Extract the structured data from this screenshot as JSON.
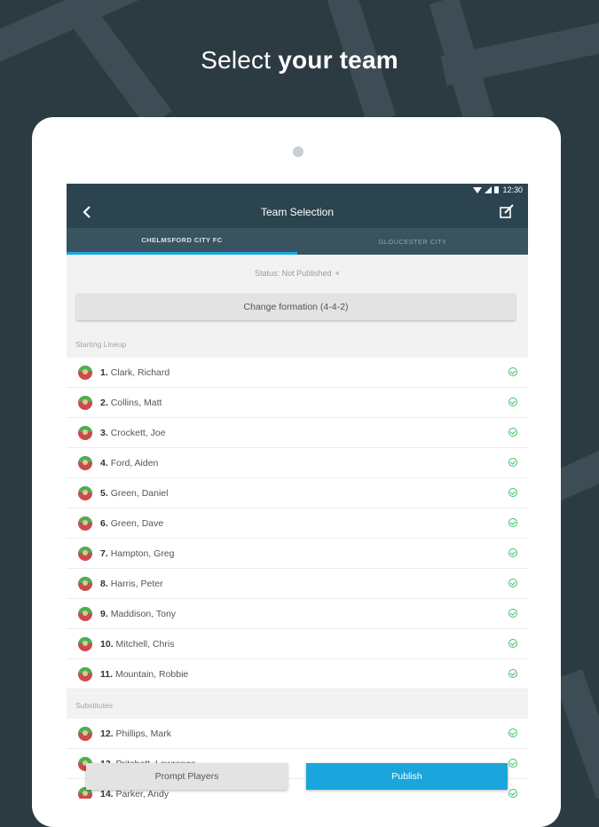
{
  "headline": {
    "light": "Select ",
    "bold": "your team"
  },
  "status_bar": {
    "time": "12:30"
  },
  "app_bar": {
    "title": "Team Selection",
    "back_icon": "chevron-left-icon",
    "edit_icon": "edit-icon"
  },
  "tabs": [
    {
      "label": "CHELMSFORD CITY FC",
      "active": true
    },
    {
      "label": "GLOUCESTER CITY",
      "active": false
    }
  ],
  "status": {
    "text": "Status: Not Published",
    "close": "×"
  },
  "formation_button": "Change formation (4-4-2)",
  "starting": {
    "label": "Starting Lineup",
    "players": [
      {
        "num": "1.",
        "name": "Clark, Richard"
      },
      {
        "num": "2.",
        "name": "Collins, Matt"
      },
      {
        "num": "3.",
        "name": "Crockett, Joe"
      },
      {
        "num": "4.",
        "name": "Ford, Aiden"
      },
      {
        "num": "5.",
        "name": "Green, Daniel"
      },
      {
        "num": "6.",
        "name": "Green, Dave"
      },
      {
        "num": "7.",
        "name": "Hampton, Greg"
      },
      {
        "num": "8.",
        "name": "Harris, Peter"
      },
      {
        "num": "9.",
        "name": "Maddison, Tony"
      },
      {
        "num": "10.",
        "name": "Mitchell, Chris"
      },
      {
        "num": "11.",
        "name": "Mountain, Robbie"
      }
    ]
  },
  "substitutes": {
    "label": "Substitutes",
    "players": [
      {
        "num": "12.",
        "name": "Phillips, Mark"
      },
      {
        "num": "13.",
        "name": "Pritchett, Lawrence"
      },
      {
        "num": "14.",
        "name": "Parker, Andy"
      }
    ]
  },
  "buttons": {
    "prompt": "Prompt Players",
    "publish": "Publish"
  },
  "colors": {
    "appbar": "#2b4450",
    "tab_indicator": "#18a9e0",
    "publish": "#1aa6dc",
    "check": "#3fbf6c"
  }
}
